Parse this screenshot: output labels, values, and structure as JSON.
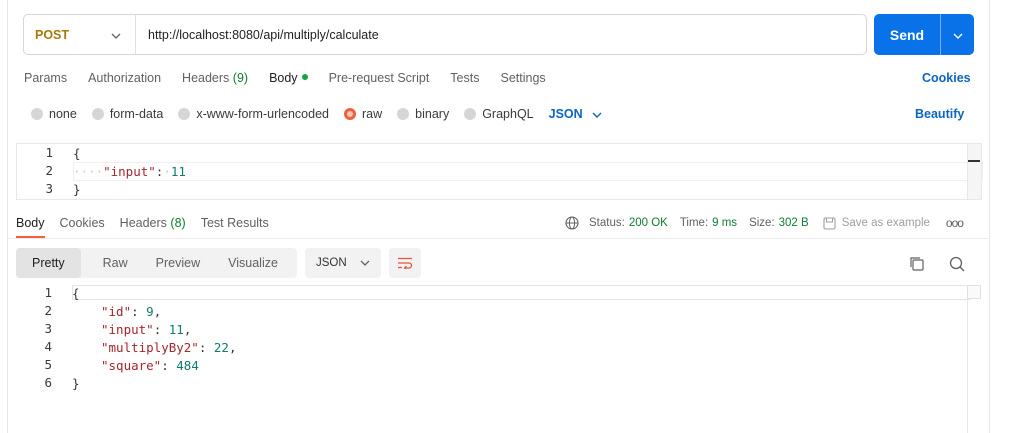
{
  "request": {
    "method": "POST",
    "url": "http://localhost:8080/api/multiply/calculate",
    "send_label": "Send"
  },
  "tabs": [
    {
      "label": "Params",
      "count": ""
    },
    {
      "label": "Authorization",
      "count": ""
    },
    {
      "label": "Headers",
      "count": "(9)"
    },
    {
      "label": "Body",
      "count": "",
      "active": true
    },
    {
      "label": "Pre-request Script",
      "count": ""
    },
    {
      "label": "Tests",
      "count": ""
    },
    {
      "label": "Settings",
      "count": ""
    }
  ],
  "cookies_label": "Cookies",
  "body_types": [
    "none",
    "form-data",
    "x-www-form-urlencoded",
    "raw",
    "binary",
    "GraphQL"
  ],
  "body_type_selected": "raw",
  "body_language": "JSON",
  "beautify_label": "Beautify",
  "request_body": {
    "line_numbers": [
      "1",
      "2",
      "3"
    ],
    "open": "{",
    "key": "\"input\"",
    "colon": ":",
    "value": "11",
    "close": "}"
  },
  "response": {
    "tabs": [
      {
        "label": "Body",
        "count": "",
        "active": true
      },
      {
        "label": "Cookies",
        "count": ""
      },
      {
        "label": "Headers",
        "count": "(8)"
      },
      {
        "label": "Test Results",
        "count": ""
      }
    ],
    "status_label": "Status:",
    "status_value": "200 OK",
    "time_label": "Time:",
    "time_value": "9 ms",
    "size_label": "Size:",
    "size_value": "302 B",
    "save_label": "Save as example",
    "more_label": "ooo",
    "views": [
      "Pretty",
      "Raw",
      "Preview",
      "Visualize"
    ],
    "format": "JSON",
    "line_numbers": [
      "1",
      "2",
      "3",
      "4",
      "5",
      "6"
    ],
    "lines": [
      {
        "key": "\"id\"",
        "value": "9",
        "comma": ","
      },
      {
        "key": "\"input\"",
        "value": "11",
        "comma": ","
      },
      {
        "key": "\"multiplyBy2\"",
        "value": "22",
        "comma": ","
      },
      {
        "key": "\"square\"",
        "value": "484",
        "comma": ""
      }
    ],
    "open": "{",
    "close": "}"
  },
  "colors": {
    "method": "#a8780a",
    "send": "#0a72e8",
    "accent": "#f25f3a",
    "link": "#0a66c2",
    "status_ok": "#0f7b34",
    "json_key": "#a4262c",
    "json_number": "#0f7b6c"
  }
}
